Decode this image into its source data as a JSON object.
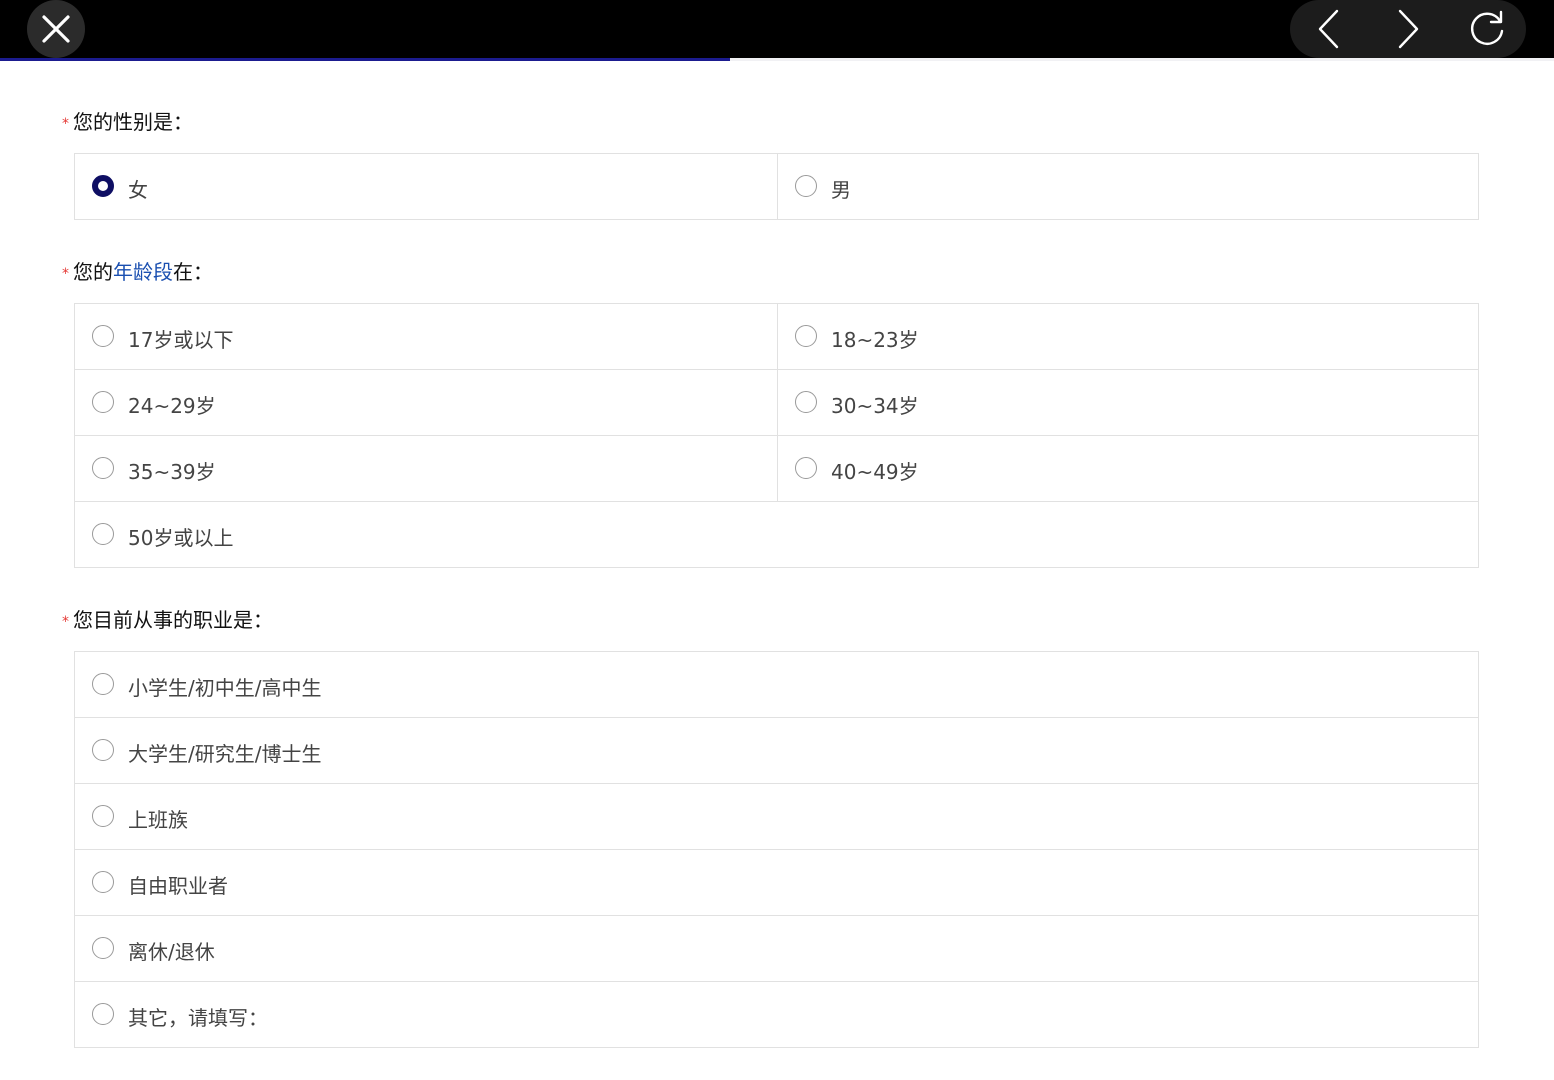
{
  "header": {
    "close_icon": "close-icon",
    "back_icon": "chevron-left-icon",
    "forward_icon": "chevron-right-icon",
    "refresh_icon": "refresh-icon",
    "progress_fraction": 0.47,
    "progress_color": "#1b1b8f"
  },
  "questions": [
    {
      "required_mark": "*",
      "title_prefix": "您的性别是：",
      "options": [
        {
          "label": "女",
          "selected": true
        },
        {
          "label": "男",
          "selected": false
        }
      ]
    },
    {
      "required_mark": "*",
      "title_prefix": "您的",
      "title_highlight": "年龄段",
      "title_suffix": "在：",
      "options": [
        {
          "label": "17岁或以下",
          "selected": false
        },
        {
          "label": "18~23岁",
          "selected": false
        },
        {
          "label": "24~29岁",
          "selected": false
        },
        {
          "label": "30~34岁",
          "selected": false
        },
        {
          "label": "35~39岁",
          "selected": false
        },
        {
          "label": "40~49岁",
          "selected": false
        },
        {
          "label": "50岁或以上",
          "selected": false
        }
      ]
    },
    {
      "required_mark": "*",
      "title_prefix": "您目前从事的职业是：",
      "options": [
        {
          "label": "小学生/初中生/高中生",
          "selected": false
        },
        {
          "label": "大学生/研究生/博士生",
          "selected": false
        },
        {
          "label": "上班族",
          "selected": false
        },
        {
          "label": "自由职业者",
          "selected": false
        },
        {
          "label": "离休/退休",
          "selected": false
        },
        {
          "label": "其它，请填写：",
          "selected": false
        }
      ]
    }
  ],
  "colors": {
    "required": "#e53935",
    "highlight": "#1a4fb0",
    "radio_checked": "#0e0e63"
  }
}
